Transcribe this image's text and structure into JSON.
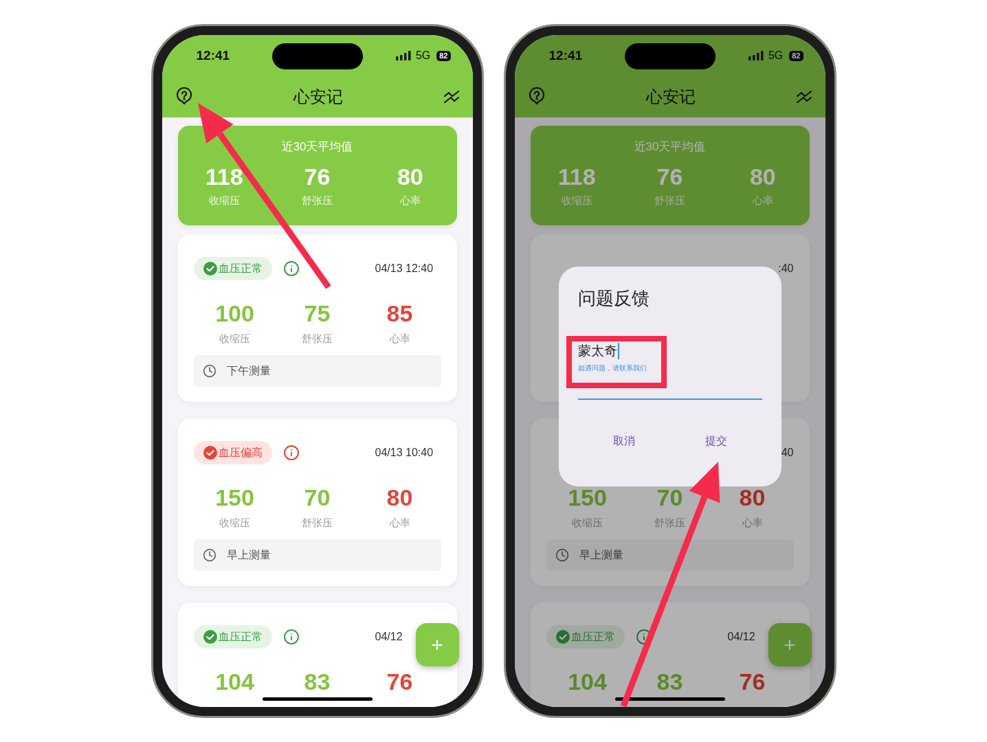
{
  "phones": [
    {
      "status": {
        "time": "12:41",
        "network": "5G",
        "battery": "82"
      },
      "header": {
        "title": "心安记"
      },
      "summary": {
        "title": "近30天平均值",
        "stats": [
          {
            "value": "118",
            "label": "收缩压"
          },
          {
            "value": "76",
            "label": "舒张压"
          },
          {
            "value": "80",
            "label": "心率"
          }
        ]
      },
      "records": [
        {
          "status": {
            "label": "血压正常",
            "kind": "normal"
          },
          "datetime": "04/13 12:40",
          "datetime_clipped": false,
          "readings": [
            {
              "value": "100",
              "label": "收缩压",
              "alert": false
            },
            {
              "value": "75",
              "label": "舒张压",
              "alert": false
            },
            {
              "value": "85",
              "label": "心率",
              "alert": true
            }
          ],
          "note": "下午测量"
        },
        {
          "status": {
            "label": "血压偏高",
            "kind": "high"
          },
          "datetime": "04/13 10:40",
          "datetime_clipped": false,
          "readings": [
            {
              "value": "150",
              "label": "收缩压",
              "alert": false
            },
            {
              "value": "70",
              "label": "舒张压",
              "alert": false
            },
            {
              "value": "80",
              "label": "心率",
              "alert": true
            }
          ],
          "note": "早上测量"
        },
        {
          "status": {
            "label": "血压正常",
            "kind": "normal"
          },
          "datetime": "04/12",
          "datetime_clipped": false,
          "readings": [
            {
              "value": "104",
              "alert": false
            },
            {
              "value": "83",
              "alert": false
            },
            {
              "value": "76",
              "alert": true
            }
          ]
        }
      ],
      "fab": {
        "label": "+"
      },
      "annotations": [
        {
          "kind": "pointer"
        }
      ]
    },
    {
      "status": {
        "time": "12:41",
        "network": "5G",
        "battery": "82"
      },
      "header": {
        "title": "心安记"
      },
      "summary": {
        "title": "近30天平均值",
        "stats": [
          {
            "value": "118",
            "label": "收缩压"
          },
          {
            "value": "76",
            "label": "舒张压"
          },
          {
            "value": "80",
            "label": "心率"
          }
        ]
      },
      "records": [
        {
          "datetime": ":40",
          "datetime_clipped": true
        },
        {
          "datetime": "40",
          "datetime_clipped": true,
          "readings": [
            {
              "value": "150",
              "label": "收缩压",
              "alert": false
            },
            {
              "value": "70",
              "label": "舒张压",
              "alert": false
            },
            {
              "value": "80",
              "label": "心率",
              "alert": true
            }
          ],
          "note": "早上测量"
        },
        {
          "status": {
            "label": "血压正常",
            "kind": "normal"
          },
          "datetime": "04/12",
          "datetime_clipped": false,
          "readings": [
            {
              "value": "104",
              "alert": false
            },
            {
              "value": "83",
              "alert": false
            },
            {
              "value": "76",
              "alert": true
            }
          ]
        }
      ],
      "fab": {
        "label": "+"
      },
      "dialog": {
        "title": "问题反馈",
        "input": {
          "value": "蒙太奇",
          "helper": "如遇问题，请联系我们"
        },
        "actions": [
          {
            "label": "取消"
          },
          {
            "label": "提交"
          }
        ]
      },
      "annotations": [
        {
          "kind": "frame"
        },
        {
          "kind": "riser"
        }
      ]
    }
  ]
}
